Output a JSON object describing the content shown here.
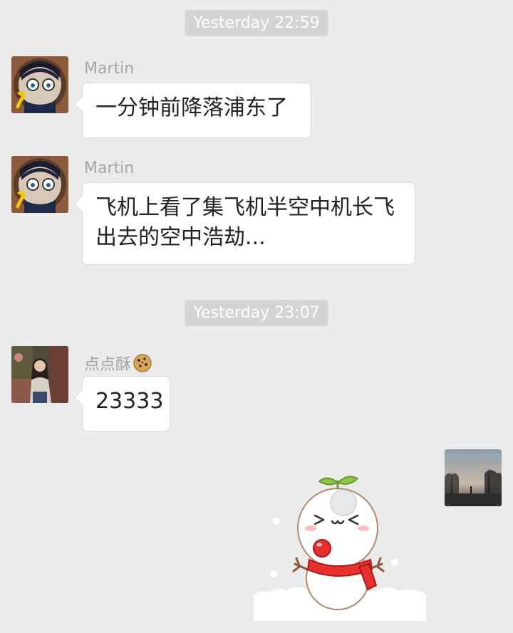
{
  "chat": {
    "timestamps": [
      "Yesterday 22:59",
      "Yesterday 23:07"
    ],
    "messages": [
      {
        "sender": "Martin",
        "text": "一分钟前降落浦东了",
        "avatar": "detective-avatar-icon"
      },
      {
        "sender": "Martin",
        "text": "飞机上看了集飞机半空中机长飞出去的空中浩劫...",
        "avatar": "detective-avatar-icon"
      },
      {
        "sender": "点点酥",
        "text": "23333",
        "avatar": "girl-photo-avatar-icon"
      }
    ],
    "own_message": {
      "type": "sticker",
      "sticker": "snowman-sticker-icon",
      "avatar": "sunset-trees-avatar-icon"
    }
  },
  "colors": {
    "background": "#ebebeb",
    "timestamp_bg": "#d4d4d4",
    "bubble_bg": "#ffffff",
    "sender_name": "#a6a6a6"
  }
}
